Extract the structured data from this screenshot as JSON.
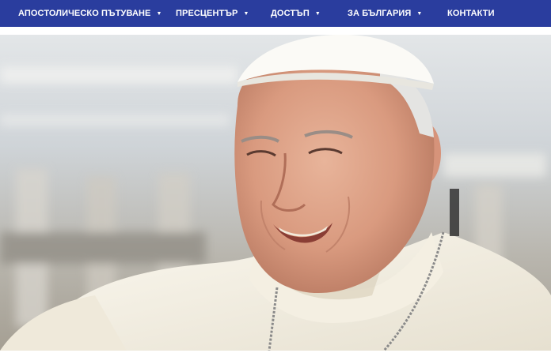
{
  "nav": {
    "items": [
      {
        "label": "АПОСТОЛИЧЕСКО ПЪТУВАНЕ",
        "dropdown": true
      },
      {
        "label": "ПРЕСЦЕНТЪР",
        "dropdown": true
      },
      {
        "label": "ДОСТЪП",
        "dropdown": true
      },
      {
        "label": "ЗА БЪЛГАРИЯ",
        "dropdown": true
      },
      {
        "label": "КОНТАКТИ",
        "dropdown": false
      }
    ],
    "caret_icon": "chevron-down-icon"
  },
  "colors": {
    "nav_background": "#2a3d9e",
    "nav_text": "#ffffff"
  },
  "hero": {
    "image": "portrait photo of a smiling man wearing a white skullcap and white cassock, blurred building background"
  }
}
